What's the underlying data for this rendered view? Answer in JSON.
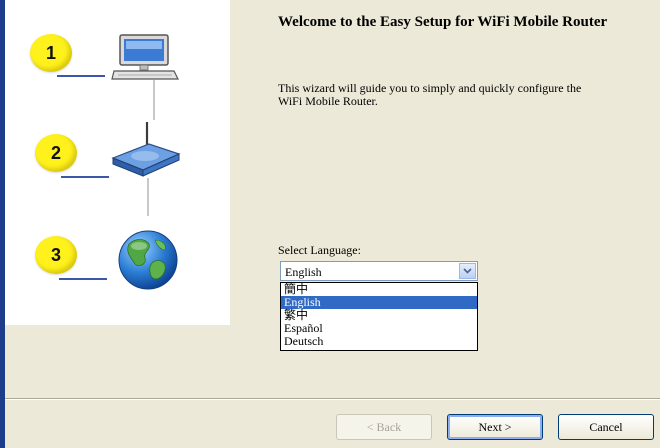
{
  "steps": [
    {
      "number": "1",
      "icon": "computer-icon"
    },
    {
      "number": "2",
      "icon": "router-icon"
    },
    {
      "number": "3",
      "icon": "globe-icon"
    }
  ],
  "title": "Welcome to the Easy Setup for WiFi Mobile Router",
  "description": "This wizard will guide you to simply and quickly configure the WiFi Mobile Router.",
  "language": {
    "label": "Select Language:",
    "selected": "English",
    "options": [
      "簡中",
      "English",
      "繁中",
      "Español",
      "Deutsch"
    ],
    "highlighted_index": 1
  },
  "buttons": {
    "back": "< Back",
    "next": "Next >",
    "cancel": "Cancel"
  },
  "colors": {
    "step_badge": "#fff21c",
    "selection": "#316ac5",
    "accent_bar": "#1e3c8c"
  }
}
